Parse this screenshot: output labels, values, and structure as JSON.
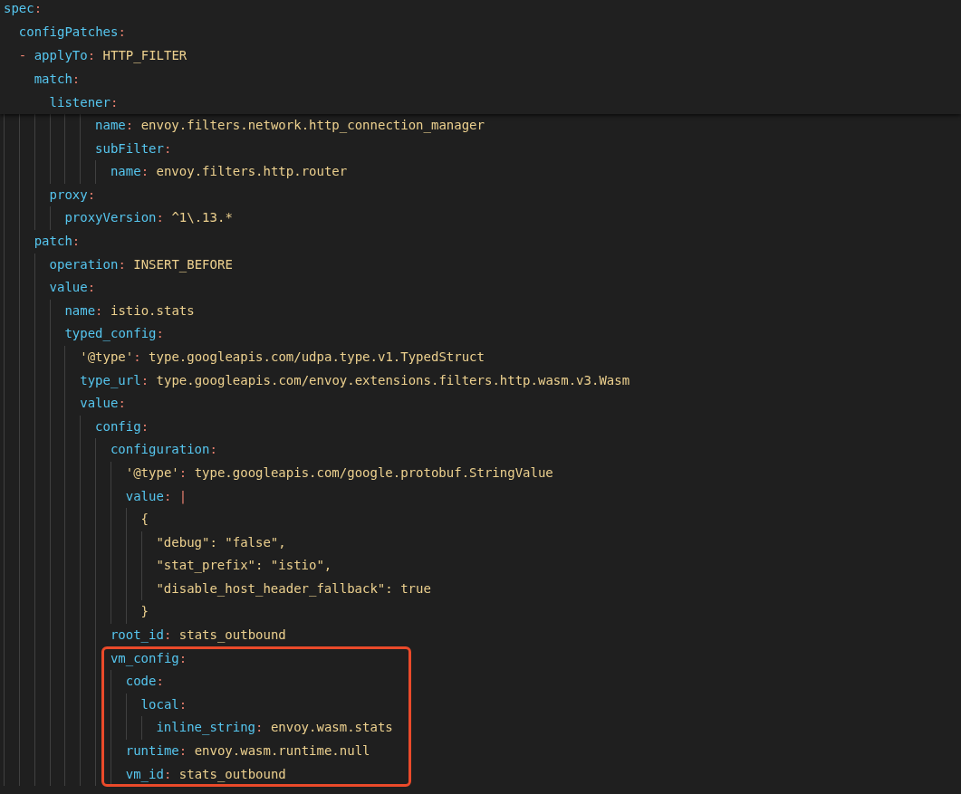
{
  "sticky_header": [
    {
      "kind": "map",
      "key": "spec",
      "sep": ":",
      "children": [
        {
          "kind": "map",
          "key": "configPatches",
          "sep": ":",
          "children": [
            {
              "kind": "list_item",
              "dash": "-",
              "children": [
                {
                  "kind": "pair",
                  "key": "applyTo",
                  "sep": ":",
                  "value": "HTTP_FILTER"
                },
                {
                  "kind": "map",
                  "key": "match",
                  "sep": ":",
                  "children": [
                    {
                      "kind": "map",
                      "key": "listener",
                      "sep": ":"
                    }
                  ]
                }
              ]
            }
          ]
        }
      ]
    }
  ],
  "editor": [
    {
      "kind": "group",
      "children": [
        {
          "kind": "group",
          "children": [
            {
              "kind": "list_item",
              "children": [
                {
                  "kind": "group",
                  "children": [
                    {
                      "kind": "group",
                      "children": [
                        {
                          "kind": "group",
                          "children": [
                            {
                              "kind": "group",
                              "children": [
                                {
                                  "kind": "pair",
                                  "key": "name",
                                  "sep": ":",
                                  "value": "envoy.filters.network.http_connection_manager"
                                },
                                {
                                  "kind": "map",
                                  "key": "subFilter",
                                  "sep": ":",
                                  "children": [
                                    {
                                      "kind": "pair",
                                      "key": "name",
                                      "sep": ":",
                                      "value": "envoy.filters.http.router"
                                    }
                                  ]
                                }
                              ]
                            }
                          ]
                        }
                      ]
                    },
                    {
                      "kind": "map",
                      "key": "proxy",
                      "sep": ":",
                      "children": [
                        {
                          "kind": "pair",
                          "key": "proxyVersion",
                          "sep": ":",
                          "value": "^1\\.13.*"
                        }
                      ]
                    }
                  ]
                },
                {
                  "kind": "map",
                  "key": "patch",
                  "sep": ":",
                  "children": [
                    {
                      "kind": "pair",
                      "key": "operation",
                      "sep": ":",
                      "value": "INSERT_BEFORE"
                    },
                    {
                      "kind": "map",
                      "key": "value",
                      "sep": ":",
                      "children": [
                        {
                          "kind": "pair",
                          "key": "name",
                          "sep": ":",
                          "value": "istio.stats"
                        },
                        {
                          "kind": "map",
                          "key": "typed_config",
                          "sep": ":",
                          "children": [
                            {
                              "kind": "string_pair",
                              "key": "'@type'",
                              "sep": ":",
                              "value": "type.googleapis.com/udpa.type.v1.TypedStruct"
                            },
                            {
                              "kind": "pair",
                              "key": "type_url",
                              "sep": ":",
                              "value": "type.googleapis.com/envoy.extensions.filters.http.wasm.v3.Wasm"
                            },
                            {
                              "kind": "map",
                              "key": "value",
                              "sep": ":",
                              "children": [
                                {
                                  "kind": "map",
                                  "key": "config",
                                  "sep": ":",
                                  "children": [
                                    {
                                      "kind": "map",
                                      "key": "configuration",
                                      "sep": ":",
                                      "children": [
                                        {
                                          "kind": "string_pair",
                                          "key": "'@type'",
                                          "sep": ":",
                                          "value": "type.googleapis.com/google.protobuf.StringValue"
                                        },
                                        {
                                          "kind": "block",
                                          "key": "value",
                                          "sep": ":",
                                          "value": "|",
                                          "children": [
                                            {
                                              "kind": "text",
                                              "value": "{",
                                              "children": [
                                                {
                                                  "kind": "text",
                                                  "value": "\"debug\": \"false\","
                                                },
                                                {
                                                  "kind": "text",
                                                  "value": "\"stat_prefix\": \"istio\","
                                                },
                                                {
                                                  "kind": "text",
                                                  "value": "\"disable_host_header_fallback\": true"
                                                }
                                              ]
                                            },
                                            {
                                              "kind": "text",
                                              "value": "}"
                                            }
                                          ]
                                        }
                                      ]
                                    },
                                    {
                                      "kind": "pair",
                                      "key": "root_id",
                                      "sep": ":",
                                      "value": "stats_outbound"
                                    },
                                    {
                                      "kind": "map",
                                      "key": "vm_config",
                                      "sep": ":",
                                      "highlighted": true,
                                      "children": [
                                        {
                                          "kind": "map",
                                          "key": "code",
                                          "sep": ":",
                                          "children": [
                                            {
                                              "kind": "map",
                                              "key": "local",
                                              "sep": ":",
                                              "children": [
                                                {
                                                  "kind": "pair",
                                                  "key": "inline_string",
                                                  "sep": ":",
                                                  "value": "envoy.wasm.stats"
                                                }
                                              ]
                                            }
                                          ]
                                        },
                                        {
                                          "kind": "pair",
                                          "key": "runtime",
                                          "sep": ":",
                                          "value": "envoy.wasm.runtime.null"
                                        },
                                        {
                                          "kind": "pair",
                                          "key": "vm_id",
                                          "sep": ":",
                                          "value": "stats_outbound"
                                        }
                                      ]
                                    }
                                  ]
                                }
                              ]
                            }
                          ]
                        }
                      ]
                    }
                  ]
                }
              ]
            }
          ]
        }
      ]
    }
  ]
}
